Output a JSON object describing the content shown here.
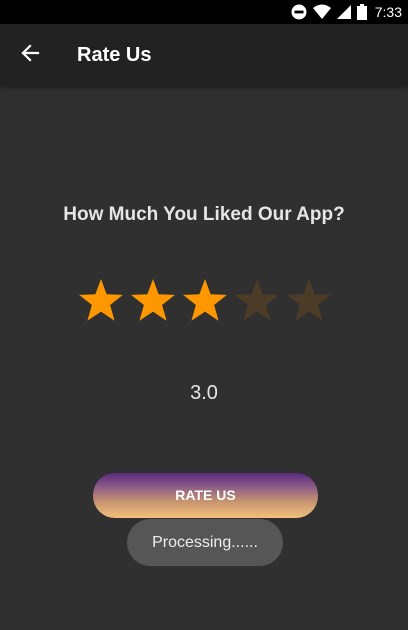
{
  "status_bar": {
    "time": "7:33",
    "icons": [
      "do-not-disturb-icon",
      "wifi-icon",
      "signal-icon",
      "battery-icon"
    ]
  },
  "app_bar": {
    "back_icon": "arrow-back-icon",
    "title": "Rate Us"
  },
  "main": {
    "question": "How Much You Liked Our App?",
    "rating": {
      "max": 5,
      "value": 3,
      "display_value": "3.0",
      "filled_color": "#ff9800",
      "empty_color": "#4c3c27"
    },
    "rate_button_label": "RATE US",
    "toast_text": "Processing......"
  },
  "colors": {
    "background": "#303030",
    "app_bar": "#222222",
    "status_bar": "#000000"
  }
}
